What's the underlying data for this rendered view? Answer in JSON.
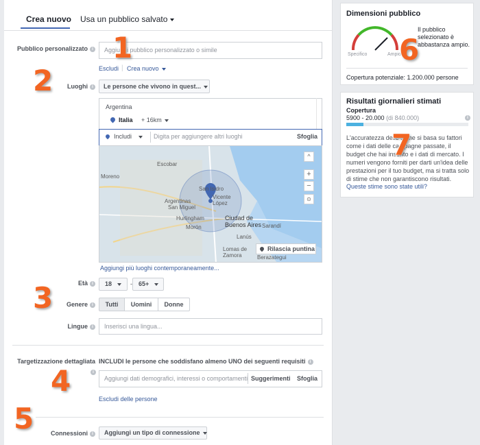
{
  "tabs": [
    {
      "label": "Crea nuovo"
    },
    {
      "label": "Usa un pubblico salvato"
    }
  ],
  "custom_audience": {
    "label": "Pubblico personalizzato",
    "placeholder": "Aggiungi pubblico personalizzato o simile",
    "exclude_link": "Escludi",
    "create_link": "Crea nuovo"
  },
  "locations": {
    "label": "Luoghi",
    "dropdown": "Le persone che vivono in quest...",
    "list_header": "Argentina",
    "item_name": "Italia",
    "item_radius": "+ 16km",
    "include_label": "Includi",
    "input_placeholder": "Digita per aggiungere altri luoghi",
    "browse": "Sfoglia",
    "add_multiple": "Aggiungi più luoghi contemporaneamente...",
    "drop_pin": "Rilascia puntina",
    "map_labels": [
      "Escobar",
      "San Isidro",
      "Vicente López",
      "Argentinas",
      "San Miguel",
      "Hurlingham",
      "Morón",
      "Ciudad de Buenos Aires",
      "Lanús",
      "Lomas de Zamora",
      "Berazategui",
      "Moreno",
      "Sarandí"
    ]
  },
  "age": {
    "label": "Età",
    "min": "18",
    "max": "65+",
    "separator": "-"
  },
  "gender": {
    "label": "Genere",
    "options": [
      "Tutti",
      "Uomini",
      "Donne"
    ]
  },
  "languages": {
    "label": "Lingue",
    "placeholder": "Inserisci una lingua..."
  },
  "detailed_targeting": {
    "label": "Targetizzazione dettagliata",
    "description": "INCLUDI le persone che soddisfano almeno UNO dei seguenti requisiti",
    "placeholder": "Aggiungi dati demografici, interessi o comportamenti",
    "suggestions": "Suggerimenti",
    "browse": "Sfoglia",
    "exclude_link": "Escludi delle persone"
  },
  "connections": {
    "label": "Connessioni",
    "dropdown": "Aggiungi un tipo di connessione"
  },
  "audience_size": {
    "title": "Dimensioni pubblico",
    "specific": "Specifico",
    "broad": "Ampio",
    "status": "Il pubblico selezionato è abbastanza ampio.",
    "reach": "Copertura potenziale: 1.200.000 persone"
  },
  "daily_results": {
    "title": "Risultati giornalieri stimati",
    "reach_label": "Copertura",
    "reach_value": "5900 - 20.000",
    "reach_total": "(di 840.000)",
    "note": "L'accuratezza delle stime si basa su fattori come i dati delle campagne passate, il budget che hai inserito e i dati di mercato. I numeri vengono forniti per darti un'idea delle prestazioni per il tuo budget, ma si tratta solo di stime che non garantiscono risultati.",
    "feedback_link": "Queste stime sono state utili?"
  },
  "callouts": [
    "1",
    "2",
    "3",
    "4",
    "5",
    "6",
    "7"
  ],
  "colors": {
    "accent": "#4267b2",
    "callout": "#f26522",
    "bar": "#4cb1e0",
    "link": "#365899"
  },
  "icons": [
    "info-icon",
    "caret-down-icon",
    "location-pin-icon",
    "zoom-in-icon",
    "zoom-out-icon",
    "recenter-icon",
    "gauge-icon"
  ]
}
